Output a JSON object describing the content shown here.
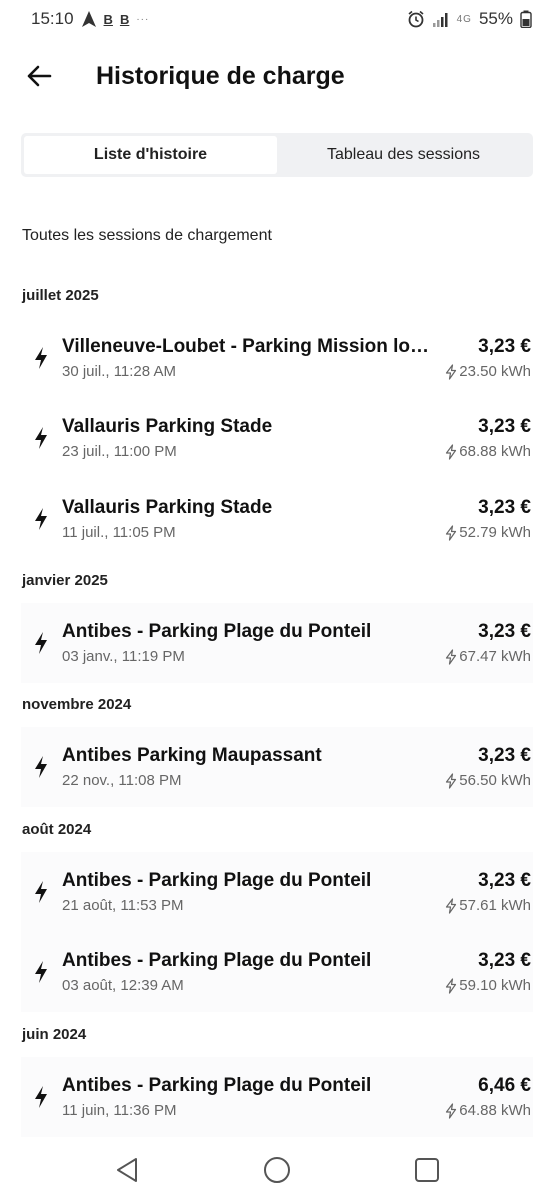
{
  "status": {
    "time": "15:10",
    "battery": "55%",
    "network": "4G"
  },
  "header": {
    "title": "Historique de charge"
  },
  "tabs": [
    {
      "label": "Liste d'histoire",
      "active": true
    },
    {
      "label": "Tableau des sessions",
      "active": false
    }
  ],
  "section_title": "Toutes les sessions de chargement",
  "groups": [
    {
      "month": "juillet 2025",
      "sessions": [
        {
          "name": "Villeneuve-Loubet - Parking Mission loc...",
          "date": "30 juil., 11:28 AM",
          "price": "3,23 €",
          "energy": "23.50 kWh"
        },
        {
          "name": "Vallauris Parking Stade",
          "date": "23 juil., 11:00 PM",
          "price": "3,23 €",
          "energy": "68.88 kWh"
        },
        {
          "name": "Vallauris Parking Stade",
          "date": "11 juil., 11:05 PM",
          "price": "3,23 €",
          "energy": "52.79 kWh"
        }
      ]
    },
    {
      "month": "janvier 2025",
      "sessions": [
        {
          "name": "Antibes - Parking Plage du Ponteil",
          "date": "03 janv., 11:19 PM",
          "price": "3,23 €",
          "energy": "67.47 kWh"
        }
      ]
    },
    {
      "month": "novembre 2024",
      "sessions": [
        {
          "name": "Antibes Parking Maupassant",
          "date": "22 nov., 11:08 PM",
          "price": "3,23 €",
          "energy": "56.50 kWh"
        }
      ]
    },
    {
      "month": "août 2024",
      "sessions": [
        {
          "name": "Antibes - Parking Plage du Ponteil",
          "date": "21 août, 11:53 PM",
          "price": "3,23 €",
          "energy": "57.61 kWh"
        },
        {
          "name": "Antibes - Parking Plage du Ponteil",
          "date": "03 août, 12:39 AM",
          "price": "3,23 €",
          "energy": "59.10 kWh"
        }
      ]
    },
    {
      "month": "juin 2024",
      "sessions": [
        {
          "name": "Antibes - Parking Plage du Ponteil",
          "date": "11 juin, 11:36 PM",
          "price": "6,46 €",
          "energy": "64.88 kWh"
        }
      ]
    }
  ]
}
